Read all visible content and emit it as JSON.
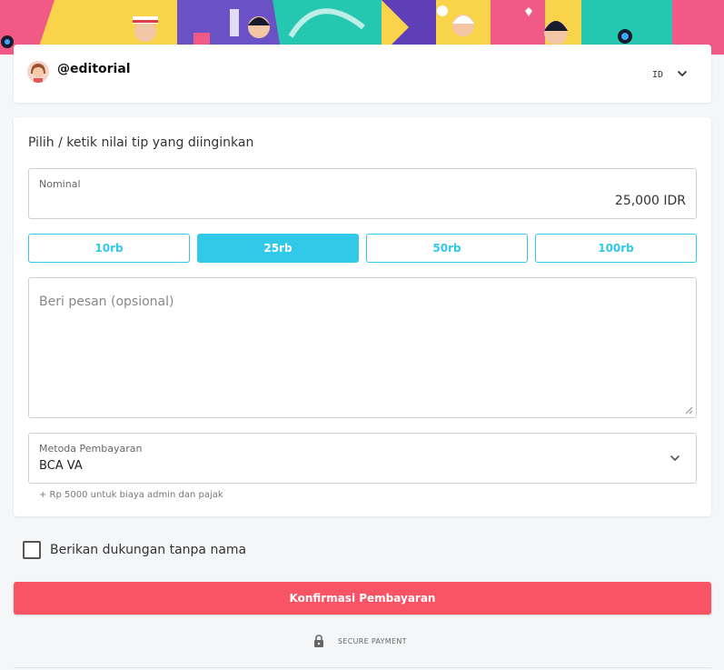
{
  "header": {
    "username": "@editorial",
    "language_code": "ID"
  },
  "form": {
    "prompt": "Pilih / ketik nilai tip yang diinginkan",
    "nominal": {
      "label": "Nominal",
      "value": "25,000 IDR"
    },
    "amount_options": [
      {
        "label": "10rb",
        "selected": false
      },
      {
        "label": "25rb",
        "selected": true
      },
      {
        "label": "50rb",
        "selected": false
      },
      {
        "label": "100rb",
        "selected": false
      }
    ],
    "message": {
      "placeholder": "Beri pesan (opsional)",
      "value": ""
    },
    "payment_method": {
      "label": "Metoda Pembayaran",
      "value": "BCA VA"
    },
    "fee_note": "+ Rp 5000 untuk biaya admin dan pajak"
  },
  "anonymous": {
    "label": "Berikan dukungan tanpa nama",
    "checked": false
  },
  "confirm_label": "Konfirmasi Pembayaran",
  "secure_label": "SECURE PAYMENT",
  "colors": {
    "accent": "#32c8e8",
    "confirm": "#f85466",
    "banner_yellow": "#f9d34a",
    "banner_purple": "#6a52c6",
    "banner_teal": "#25c7b1",
    "banner_pink": "#f25a86"
  },
  "icons": {
    "language_toggle": "chevron-down-icon",
    "payment_toggle": "chevron-down-icon",
    "secure": "lock-icon"
  }
}
